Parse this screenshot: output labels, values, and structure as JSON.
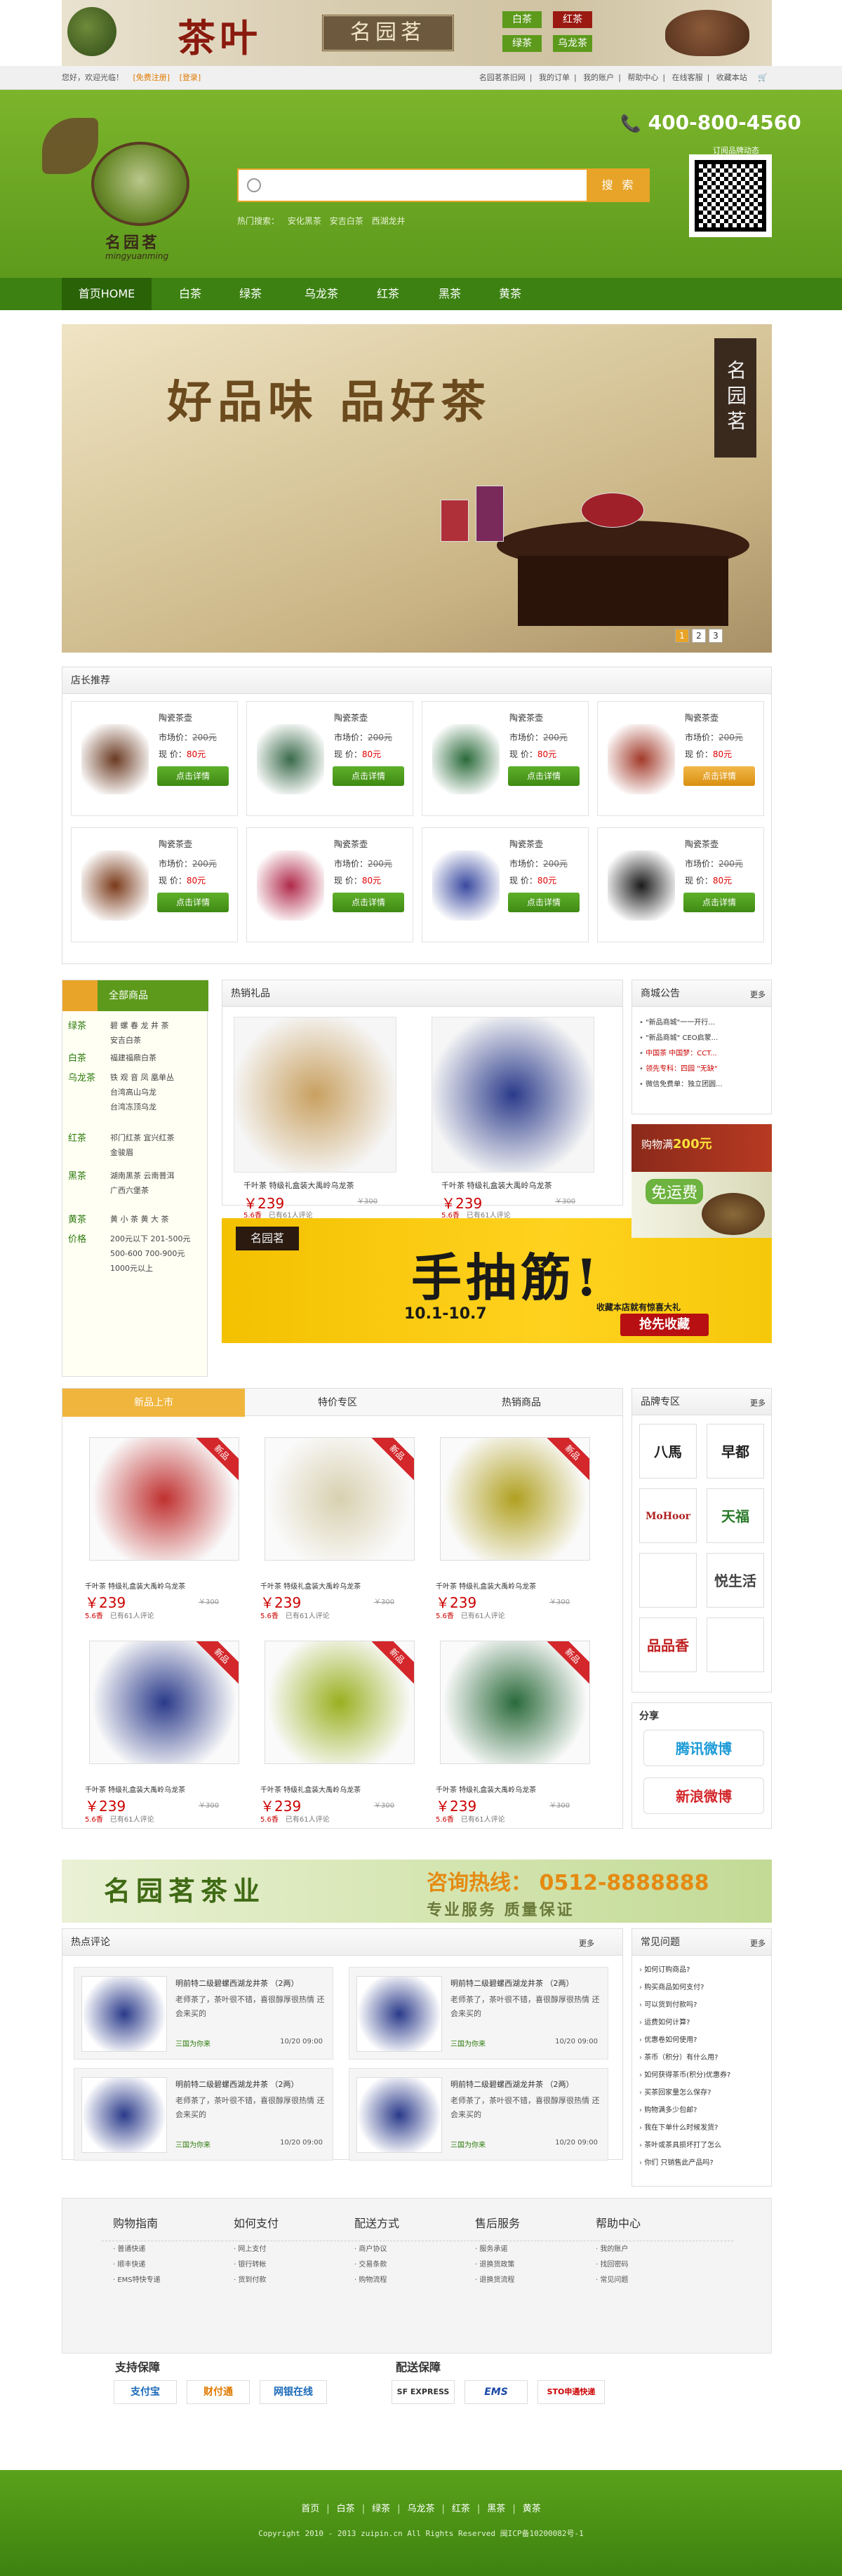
{
  "top_banner": {
    "title": "茶叶",
    "brand": "名园茗",
    "tags": [
      "白茶",
      "红茶",
      "绿茶",
      "乌龙茶"
    ]
  },
  "util": {
    "left": [
      "您好，欢迎光临！",
      "[免费注册]",
      "[登录]"
    ],
    "right": [
      "名园茗茶旧网",
      "我的订单",
      "我的账户",
      "帮助中心",
      "在线客服",
      "收藏本站"
    ]
  },
  "header": {
    "logo_name": "名园茗",
    "logo_pinyin": "mingyuanming",
    "search_button": "搜  索",
    "hot_label": "热门搜索：",
    "hot_words": [
      "安化黑茶",
      "安吉白茶",
      "西湖龙井"
    ],
    "phone": "400-800-4560",
    "qr_label": "订阅品牌动态"
  },
  "nav": [
    "首页HOME",
    "白茶",
    "绿茶",
    "乌龙茶",
    "红茶",
    "黑茶",
    "黄茶"
  ],
  "hero": {
    "title": "好品味  品好茶",
    "seal": "名园茗",
    "pages": [
      "1",
      "2",
      "3"
    ]
  },
  "recommend": {
    "title": "店长推荐",
    "items": [
      {
        "name": "陶瓷茶壶",
        "market_label": "市场价：",
        "market": "200元",
        "price_label": "现  价：",
        "price": "80元",
        "btn": "点击详情"
      },
      {
        "name": "陶瓷茶壶",
        "market_label": "市场价：",
        "market": "200元",
        "price_label": "现  价：",
        "price": "80元",
        "btn": "点击详情"
      },
      {
        "name": "陶瓷茶壶",
        "market_label": "市场价：",
        "market": "200元",
        "price_label": "现  价：",
        "price": "80元",
        "btn": "点击详情"
      },
      {
        "name": "陶瓷茶壶",
        "market_label": "市场价：",
        "market": "200元",
        "price_label": "现  价：",
        "price": "80元",
        "btn": "点击详情"
      },
      {
        "name": "陶瓷茶壶",
        "market_label": "市场价：",
        "market": "200元",
        "price_label": "现  价：",
        "price": "80元",
        "btn": "点击详情"
      },
      {
        "name": "陶瓷茶壶",
        "market_label": "市场价：",
        "market": "200元",
        "price_label": "现  价：",
        "price": "80元",
        "btn": "点击详情"
      },
      {
        "name": "陶瓷茶壶",
        "market_label": "市场价：",
        "market": "200元",
        "price_label": "现  价：",
        "price": "80元",
        "btn": "点击详情"
      },
      {
        "name": "陶瓷茶壶",
        "market_label": "市场价：",
        "market": "200元",
        "price_label": "现  价：",
        "price": "80元",
        "btn": "点击详情"
      }
    ]
  },
  "categories": {
    "title": "全部商品",
    "groups": [
      {
        "k": "绿茶",
        "v": "碧 螺 春   龙 井 茶\n安吉白茶"
      },
      {
        "k": "白茶",
        "v": "福建福鼎白茶"
      },
      {
        "k": "乌龙茶",
        "v": "铁 观 音   凤 凰单丛\n台湾高山乌龙\n台湾冻顶乌龙"
      },
      {
        "k": "红茶",
        "v": "祁门红茶   宜兴红茶\n金骏眉"
      },
      {
        "k": "黑茶",
        "v": "湖南黑茶   云南普洱\n广西六堡茶"
      },
      {
        "k": "黄茶",
        "v": "黄 小 茶   黄 大 茶"
      },
      {
        "k": "价格",
        "v": "200元以下   201-500元\n500-600     700-900元\n1000元以上"
      }
    ]
  },
  "gift": {
    "title": "热销礼品",
    "items": [
      {
        "name": "千叶茶 特级礼盒装大禹岭乌龙茶",
        "price": "￥239",
        "old": "￥300",
        "stars": "5.6香",
        "count": "已有61人评论"
      },
      {
        "name": "千叶茶 特级礼盒装大禹岭乌龙茶",
        "price": "￥239",
        "old": "￥300",
        "stars": "5.6香",
        "count": "已有61人评论"
      }
    ]
  },
  "promo": {
    "seal": "名园茗",
    "title": "手抽筋!",
    "date": "10.1-10.7",
    "sub": "收藏本店就有惊喜大礼",
    "btn": "抢先收藏"
  },
  "notice": {
    "title": "商城公告",
    "more": "更多",
    "items": [
      "\"新品商城\"一一开行...",
      "\"新品商城\" CEO启蒙...",
      "中国茶 中国梦：CCT...",
      "领先专科：四园 \"无缺\"",
      "微信免费单：独立团圆..."
    ]
  },
  "ad1": {
    "text": "购物满",
    "amount": "200元",
    "ship": "免运费"
  },
  "tabs": [
    "新品上市",
    "特价专区",
    "热销商品"
  ],
  "new_products": [
    {
      "name": "千叶茶 特级礼盒装大禹岭乌龙茶",
      "price": "￥239",
      "old": "￥300",
      "stars": "5.6香",
      "count": "已有61人评论",
      "badge": "新品"
    },
    {
      "name": "千叶茶 特级礼盒装大禹岭乌龙茶",
      "price": "￥239",
      "old": "￥300",
      "stars": "5.6香",
      "count": "已有61人评论",
      "badge": "新品"
    },
    {
      "name": "千叶茶 特级礼盒装大禹岭乌龙茶",
      "price": "￥239",
      "old": "￥300",
      "stars": "5.6香",
      "count": "已有61人评论",
      "badge": "新品"
    },
    {
      "name": "千叶茶 特级礼盒装大禹岭乌龙茶",
      "price": "￥239",
      "old": "￥300",
      "stars": "5.6香",
      "count": "已有61人评论",
      "badge": "新品"
    },
    {
      "name": "千叶茶 特级礼盒装大禹岭乌龙茶",
      "price": "￥239",
      "old": "￥300",
      "stars": "5.6香",
      "count": "已有61人评论",
      "badge": "新品"
    },
    {
      "name": "千叶茶 特级礼盒装大禹岭乌龙茶",
      "price": "￥239",
      "old": "￥300",
      "stars": "5.6香",
      "count": "已有61人评论",
      "badge": "新品"
    }
  ],
  "brand": {
    "title": "品牌专区",
    "more": "更多",
    "logos": [
      "八馬",
      "早都",
      "MoHoor",
      "天福",
      "",
      "悦生活",
      "品品香",
      ""
    ]
  },
  "share": {
    "title": "分享",
    "tencent": "腾讯微博",
    "sina": "新浪微博"
  },
  "banner2": {
    "title": "名园茗茶业",
    "phone": "咨询热线：  0512-8888888",
    "slogan": "专业服务    质量保证"
  },
  "hot_comments": {
    "title": "热点评论",
    "more": "更多",
    "items": [
      {
        "title": "明前特二级碧螺西湖龙井茶  （2两）",
        "body": "老师茶了，茶叶很不错，喜很醇厚很热情 还会来买的",
        "user": "三国为你来",
        "date": "10/20 09:00"
      },
      {
        "title": "明前特二级碧螺西湖龙井茶  （2两）",
        "body": "老师茶了，茶叶很不错，喜很醇厚很热情 还会来买的",
        "user": "三国为你来",
        "date": "10/20 09:00"
      },
      {
        "title": "明前特二级碧螺西湖龙井茶  （2两）",
        "body": "老师茶了，茶叶很不错，喜很醇厚很热情 还会来买的",
        "user": "三国为你来",
        "date": "10/20 09:00"
      },
      {
        "title": "明前特二级碧螺西湖龙井茶  （2两）",
        "body": "老师茶了，茶叶很不错，喜很醇厚很热情 还会来买的",
        "user": "三国为你来",
        "date": "10/20 09:00"
      }
    ]
  },
  "faq": {
    "title": "常见问题",
    "more": "更多",
    "items": [
      "如何订购商品?",
      "购买商品如何支付?",
      "可以货到付款吗?",
      "运费如何计算?",
      "优惠卷如何使用?",
      "茶币（积分）有什么用?",
      "如何获得茶币(积分)优惠券?",
      "买茶回家量怎么保存?",
      "购物满多少包邮?",
      "我在下单什么时候发货?",
      "茶叶或茶具损坏打了怎么",
      "你们 只销售此产品吗?"
    ]
  },
  "help": {
    "cols": [
      {
        "h": "购物指南",
        "items": [
          "普通快递",
          "顺丰快递",
          "EMS特快专递"
        ]
      },
      {
        "h": "如何支付",
        "items": [
          "网上支付",
          "银行转帐",
          "货到付款"
        ]
      },
      {
        "h": "配送方式",
        "items": [
          "商户协议",
          "交易条款",
          "购物流程"
        ]
      },
      {
        "h": "售后服务",
        "items": [
          "服务承诺",
          "退换货政策",
          "退换货流程"
        ]
      },
      {
        "h": "帮助中心",
        "items": [
          "我的账户",
          "找回密码",
          "常见问题"
        ]
      }
    ]
  },
  "guarantee": {
    "pay_title": "支持保障",
    "ship_title": "配送保障",
    "pay": [
      "支付宝",
      "财付通",
      "网银在线"
    ],
    "ship": [
      "SF EXPRESS",
      "EMS",
      "STO申通快递"
    ]
  },
  "footer": {
    "links": [
      "首页",
      "白茶",
      "绿茶",
      "乌龙茶",
      "红茶",
      "黑茶",
      "黄茶"
    ],
    "copyright": "Copyright 2010 - 2013 zuipin.cn All Rights Reserved 闽ICP备10200082号-1"
  }
}
